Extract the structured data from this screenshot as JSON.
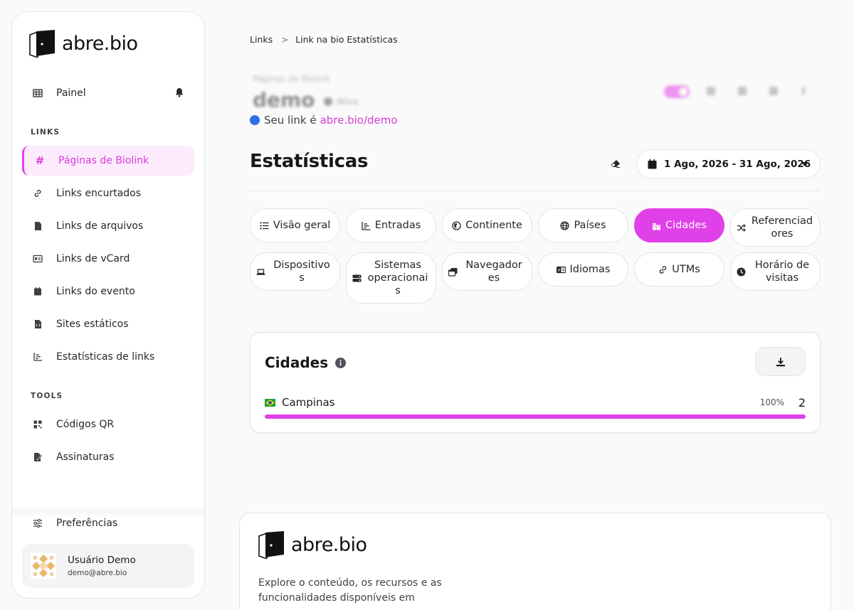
{
  "brand": {
    "name": "abre.bio"
  },
  "sidebar": {
    "dashboard": "Painel",
    "section_links": "LINKS",
    "section_tools": "TOOLS",
    "links": [
      {
        "label": "Páginas de Biolink",
        "icon": "hash-icon"
      },
      {
        "label": "Links encurtados",
        "icon": "link-icon"
      },
      {
        "label": "Links de arquivos",
        "icon": "file-icon"
      },
      {
        "label": "Links de vCard",
        "icon": "id-card-icon"
      },
      {
        "label": "Links do evento",
        "icon": "calendar-icon"
      },
      {
        "label": "Sites estáticos",
        "icon": "file-code-icon"
      },
      {
        "label": "Estatísticas de links",
        "icon": "chart-icon"
      }
    ],
    "tools": [
      {
        "label": "Códigos QR",
        "icon": "qr-icon"
      },
      {
        "label": "Assinaturas",
        "icon": "signature-icon"
      }
    ],
    "preferences": "Preferências",
    "user": {
      "name": "Usuário Demo",
      "email": "demo@abre.bio"
    }
  },
  "breadcrumb": {
    "root": "Links",
    "sep": ">",
    "current": "Link na bio Estatísticas"
  },
  "header": {
    "subtitle": "Páginas de Biolink",
    "title": "demo",
    "status": "Ativo",
    "link_prefix": "Seu link é",
    "link_url": "abre.bio/demo"
  },
  "stats": {
    "title": "Estatísticas",
    "date_range": "1 Ago, 2026 - 31 Ago, 2026"
  },
  "tabs": [
    {
      "label": "Visão geral",
      "icon": "list-icon"
    },
    {
      "label": "Entradas",
      "icon": "bar-chart-icon"
    },
    {
      "label": "Continente",
      "icon": "globe-africa-icon"
    },
    {
      "label": "Países",
      "icon": "globe-icon"
    },
    {
      "label": "Cidades",
      "icon": "city-icon",
      "active": true
    },
    {
      "label": "Referenciad ores",
      "icon": "shuffle-icon"
    },
    {
      "label": "Dispositivo s",
      "icon": "laptop-icon"
    },
    {
      "label": "Sistemas operacionai s",
      "icon": "server-icon"
    },
    {
      "label": "Navegador es",
      "icon": "window-icon"
    },
    {
      "label": "Idiomas",
      "icon": "language-icon"
    },
    {
      "label": "UTMs",
      "icon": "link-icon"
    },
    {
      "label": "Horário de visitas",
      "icon": "clock-icon"
    }
  ],
  "cities_card": {
    "title": "Cidades",
    "rows": [
      {
        "city": "Campinas",
        "country_flag": "brazil-flag-icon",
        "percent": "100%",
        "percent_value": 100,
        "count": "2"
      }
    ]
  },
  "footer": {
    "description": "Explore o conteúdo, os recursos e as funcionalidades disponíveis em"
  },
  "colors": {
    "accent": "#e040e8",
    "accent_bg": "#fcebfd",
    "link_dot": "#2f6fe8"
  }
}
